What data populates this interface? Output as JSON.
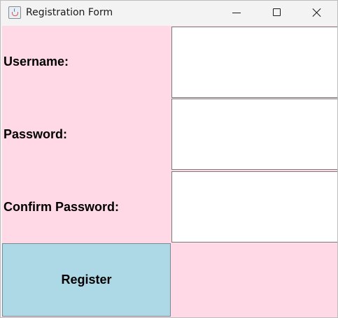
{
  "window": {
    "title": "Registration Form",
    "app_icon": "java-cup-icon"
  },
  "form": {
    "username_label": "Username:",
    "username_value": "",
    "password_label": "Password:",
    "password_value": "",
    "confirm_label": "Confirm Password:",
    "confirm_value": "",
    "register_label": "Register"
  },
  "colors": {
    "panel_background": "#ffd9e6",
    "button_background": "#add8e6",
    "field_background": "#ffffff"
  }
}
